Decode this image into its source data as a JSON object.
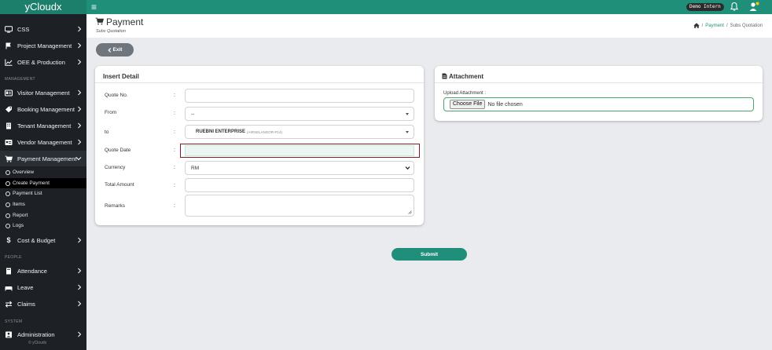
{
  "app": {
    "brand": "yCloudx",
    "demo_badge": "Demo Intern"
  },
  "colors": {
    "primary": "#1f8f7a",
    "sidebar": "#1d2126",
    "invalid_border": "#8b1a1a",
    "file_border": "#49a76e"
  },
  "sidebar": {
    "items": [
      {
        "label": "CSS",
        "icon": "monitor-icon"
      },
      {
        "label": "Project Management",
        "icon": "flag-icon"
      },
      {
        "label": "OEE & Production",
        "icon": "chart-icon"
      },
      {
        "label": "Visitor Management",
        "icon": "id-card-icon"
      },
      {
        "label": "Booking Management",
        "icon": "tag-icon"
      },
      {
        "label": "Tenant Management",
        "icon": "building-icon"
      },
      {
        "label": "Vendor Management",
        "icon": "vendor-card-icon"
      },
      {
        "label": "Payment Management",
        "icon": "cart-icon"
      },
      {
        "label": "Cost & Budget",
        "icon": "dollar-icon"
      },
      {
        "label": "Attendance",
        "icon": "book-icon"
      },
      {
        "label": "Leave",
        "icon": "bed-icon"
      },
      {
        "label": "Claims",
        "icon": "exchange-icon"
      },
      {
        "label": "Administration",
        "icon": "admin-icon"
      }
    ],
    "sections": {
      "management": "MANAGEMENT",
      "people": "PEOPLE",
      "system": "SYSTEM"
    },
    "payment_sub": [
      {
        "label": "Overview"
      },
      {
        "label": "Create Payment"
      },
      {
        "label": "Payment List"
      },
      {
        "label": "Items"
      },
      {
        "label": "Report"
      },
      {
        "label": "Logs"
      }
    ],
    "footer": "© yCloudx"
  },
  "header": {
    "title": "Payment",
    "subtitle": "Subs Quotation",
    "breadcrumb": {
      "separator": "/",
      "link": "Payment",
      "current": "Subs Quotation"
    }
  },
  "exit_button": {
    "label": "Exit"
  },
  "insert_detail": {
    "title": "Insert Detail",
    "colon": ":",
    "fields": {
      "quote_no": {
        "label": "Quote No.",
        "value": ""
      },
      "from": {
        "label": "From",
        "value": "--"
      },
      "to": {
        "label": "to",
        "value": "RUEBNI ENTERPRISE",
        "hint": "(AIRSELANGOR-P14)"
      },
      "quote_date": {
        "label": "Quote Date",
        "value": ""
      },
      "currency": {
        "label": "Currency",
        "value": "RM"
      },
      "total_amount": {
        "label": "Total Amount",
        "value": ""
      },
      "remarks": {
        "label": "Remarks",
        "value": ""
      }
    }
  },
  "attachment": {
    "title": "Attachment",
    "label": "Upload Attachment :",
    "button": "Choose File",
    "status": "No file chosen"
  },
  "submit": {
    "label": "Submit"
  }
}
